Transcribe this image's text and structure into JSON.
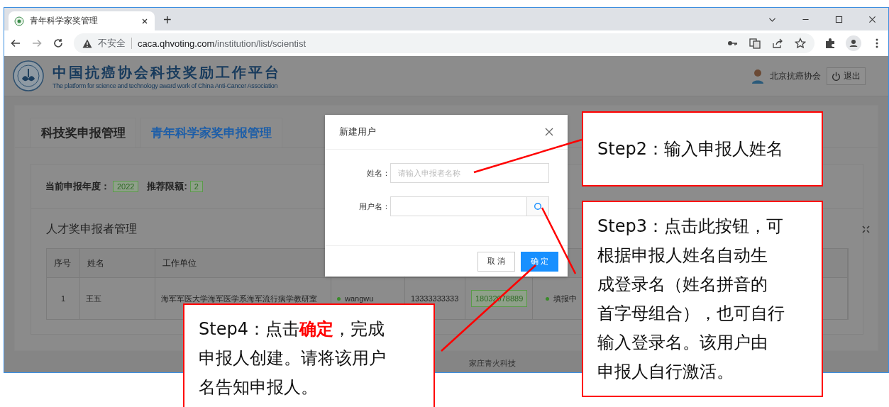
{
  "browser": {
    "tab_title": "青年科学家奖管理",
    "new_tab": "+",
    "url_warning": "不安全",
    "url_host": "caca.qhvoting.com",
    "url_path": "/institution/list/scientist"
  },
  "header": {
    "title": "中国抗癌协会科技奖励工作平台",
    "subtitle": "The platform for science and technology award work of China Anti-Cancer Association",
    "user": "北京抗癌协会",
    "logout": "退出"
  },
  "tabs": [
    {
      "label": "科技奖申报管理",
      "selected": false
    },
    {
      "label": "青年科学家奖申报管理",
      "selected": true
    }
  ],
  "summary": {
    "year_label": "当前申报年度：",
    "year": "2022",
    "quota_label": "推荐限额:",
    "quota": "2"
  },
  "section_title": "人才奖申报者管理",
  "table": {
    "columns": [
      "序号",
      "姓名",
      "工作单位"
    ],
    "rows": [
      {
        "index": "1",
        "name": "王五",
        "unit": "海军军医大学海军医学系海军流行病学教研室",
        "username": "wangwu",
        "phone": "13333333333",
        "tag": "18032078889",
        "status": "填报中"
      }
    ]
  },
  "footer": "家庄青火科技",
  "dialog": {
    "title": "新建用户",
    "fields": [
      {
        "kind": "text",
        "label": "姓名：",
        "placeholder": "请输入申报者名称"
      },
      {
        "kind": "generate",
        "label": "用户名："
      }
    ],
    "buttons": [
      {
        "label": "取 消",
        "primary": false
      },
      {
        "label": "确 定",
        "primary": true
      }
    ]
  },
  "annotations": [
    {
      "lines": [
        "Step2：输入申报人姓名"
      ]
    },
    {
      "lines": [
        "Step3：点击此按钮，可",
        "根据申报人姓名自动生",
        "成登录名（姓名拼音的",
        "首字母组合），也可自行",
        "输入登录名。该用户由",
        "申报人自行激活。"
      ]
    },
    {
      "lines": [
        "Step4：点击**确定**，完成",
        "申报人创建。请将该用户",
        "名告知申报人。"
      ]
    }
  ]
}
